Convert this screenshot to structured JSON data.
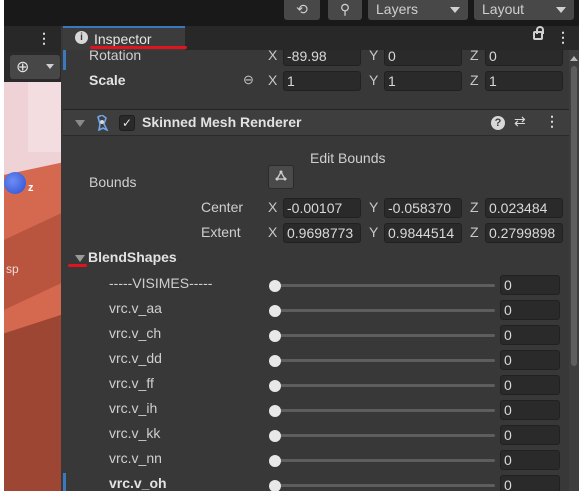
{
  "toolbar": {
    "history_icon": "history-icon",
    "search_icon": "search-icon",
    "layers_label": "Layers",
    "layout_label": "Layout"
  },
  "scene": {
    "gizmo_icon": "move-gizmo-icon",
    "viewport_axis_label": "z",
    "viewport_text": "sp"
  },
  "inspector": {
    "tab_label": "Inspector",
    "rotation": {
      "label": "Rotation",
      "x": "-89.98",
      "y": "0",
      "z": "0"
    },
    "scale": {
      "label": "Scale",
      "x": "1",
      "y": "1",
      "z": "1"
    },
    "axes": {
      "x": "X",
      "y": "Y",
      "z": "Z"
    },
    "component": {
      "title": "Skinned Mesh Renderer",
      "enabled_mark": "✓",
      "edit_bounds_label": "Edit Bounds",
      "bounds_label": "Bounds",
      "center": {
        "label": "Center",
        "x": "-0.00107",
        "y": "-0.058370",
        "z": "0.023484"
      },
      "extent": {
        "label": "Extent",
        "x": "0.9698773",
        "y": "0.9844514",
        "z": "0.2799898"
      },
      "blendshapes_label": "BlendShapes",
      "blendshapes": [
        {
          "name": "-----VISIMES-----",
          "value": "0",
          "level": 0
        },
        {
          "name": "vrc.v_aa",
          "value": "0",
          "level": 0
        },
        {
          "name": "vrc.v_ch",
          "value": "0",
          "level": 0
        },
        {
          "name": "vrc.v_dd",
          "value": "0",
          "level": 0
        },
        {
          "name": "vrc.v_ff",
          "value": "0",
          "level": 0
        },
        {
          "name": "vrc.v_ih",
          "value": "0",
          "level": 0
        },
        {
          "name": "vrc.v_kk",
          "value": "0",
          "level": 0
        },
        {
          "name": "vrc.v_nn",
          "value": "0",
          "level": 0
        },
        {
          "name": "vrc.v_oh",
          "value": "0",
          "level": 0
        }
      ]
    }
  },
  "colors": {
    "accent_blue": "#3a79bb",
    "annotation_red": "#e0141e",
    "panel_bg": "#383838",
    "field_bg": "#2a2a2a"
  }
}
